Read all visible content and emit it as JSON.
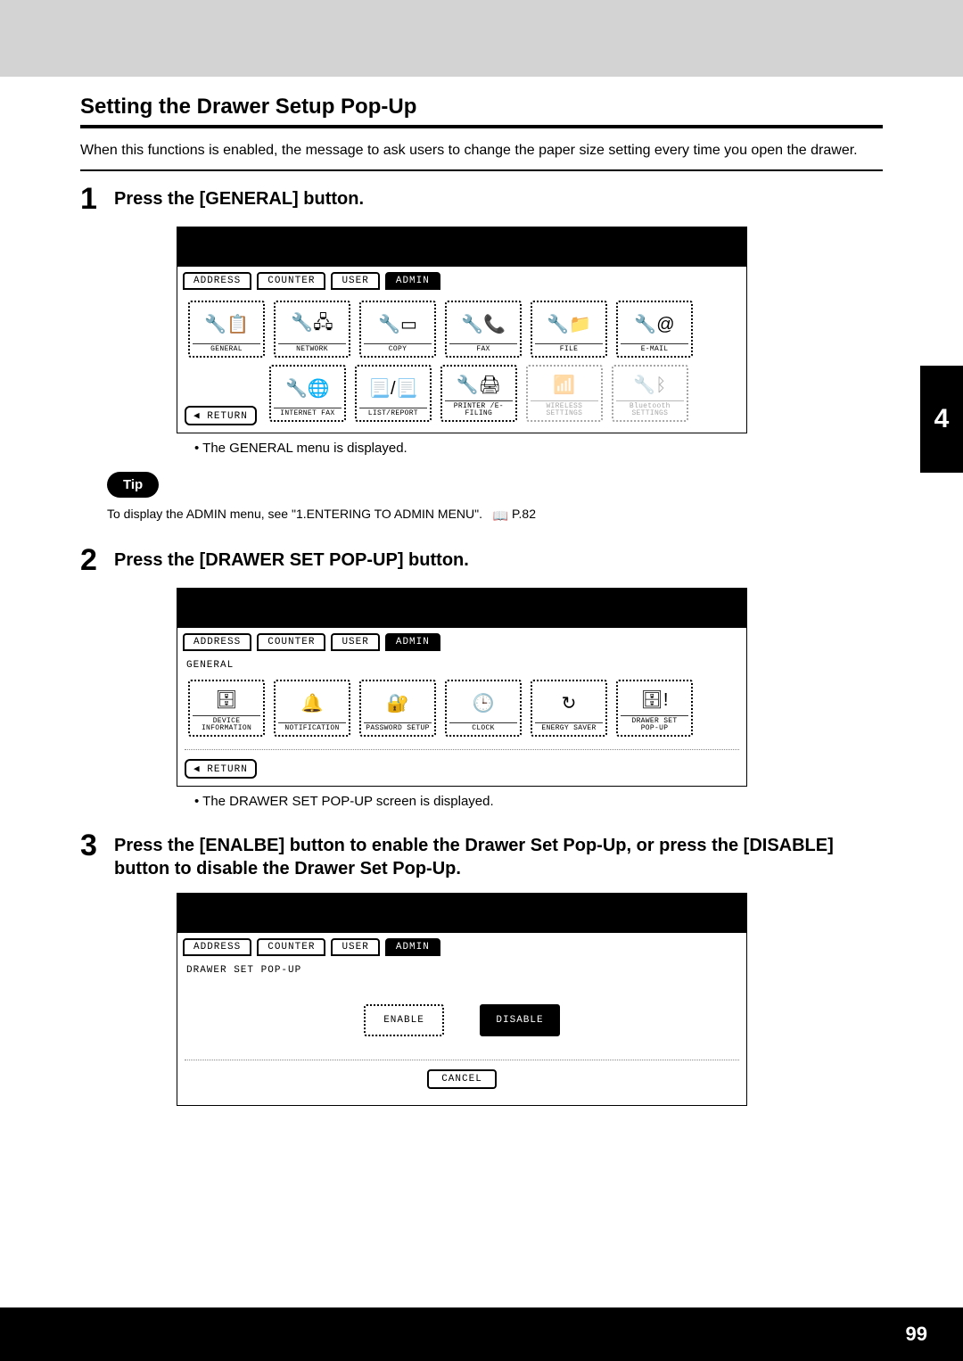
{
  "section_title": "Setting the Drawer Setup Pop-Up",
  "intro": "When this functions is enabled, the message to ask users to change the paper size setting every time you open the drawer.",
  "side_tab": "4",
  "page_number": "99",
  "tip_badge": "Tip",
  "tip_text_prefix": "To display the ADMIN menu, see \"1.ENTERING TO ADMIN MENU\".",
  "tip_text_page": "P.82",
  "tabs": {
    "address": "ADDRESS",
    "counter": "COUNTER",
    "user": "USER",
    "admin": "ADMIN"
  },
  "return_label": "RETURN",
  "cancel_label": "CANCEL",
  "steps": {
    "s1": {
      "num": "1",
      "title": "Press the [GENERAL] button.",
      "bullet": "The GENERAL menu is displayed.",
      "icons": [
        {
          "label": "GENERAL",
          "glyph": "🔧📋"
        },
        {
          "label": "NETWORK",
          "glyph": "🔧🖧"
        },
        {
          "label": "COPY",
          "glyph": "🔧▭"
        },
        {
          "label": "FAX",
          "glyph": "🔧📞"
        },
        {
          "label": "FILE",
          "glyph": "🔧📁"
        },
        {
          "label": "E-MAIL",
          "glyph": "🔧@"
        }
      ],
      "icons_row2": [
        {
          "label": "INTERNET FAX",
          "glyph": "🔧🌐"
        },
        {
          "label": "LIST/REPORT",
          "glyph": "📃/📃"
        },
        {
          "label": "PRINTER /E-FILING",
          "glyph": "🔧🖨"
        },
        {
          "label": "WIRELESS SETTINGS",
          "glyph": "📶",
          "disabled": true
        },
        {
          "label": "Bluetooth SETTINGS",
          "glyph": "🔧ᛒ",
          "disabled": true
        }
      ]
    },
    "s2": {
      "num": "2",
      "title": "Press the [DRAWER SET POP-UP] button.",
      "crumb": "GENERAL",
      "bullet": "The DRAWER SET POP-UP screen is displayed.",
      "icons": [
        {
          "label": "DEVICE INFORMATION",
          "glyph": "🗄"
        },
        {
          "label": "NOTIFICATION",
          "glyph": "🔔"
        },
        {
          "label": "PASSWORD SETUP",
          "glyph": "🔐"
        },
        {
          "label": "CLOCK",
          "glyph": "🕒"
        },
        {
          "label": "ENERGY SAVER",
          "glyph": "↻"
        },
        {
          "label": "DRAWER SET POP-UP",
          "glyph": "🗄!"
        }
      ]
    },
    "s3": {
      "num": "3",
      "title": "Press the [ENALBE] button to enable the Drawer Set Pop-Up, or press the [DISABLE] button to disable the Drawer Set Pop-Up.",
      "crumb": "DRAWER SET POP-UP",
      "enable": "ENABLE",
      "disable": "DISABLE"
    }
  }
}
